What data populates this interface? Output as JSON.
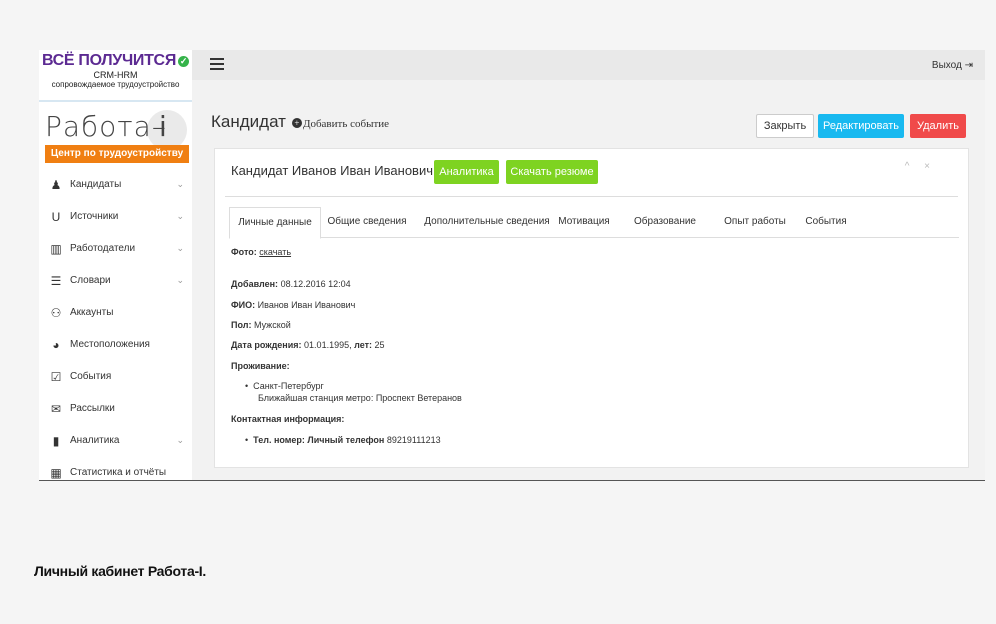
{
  "brand": {
    "title": "ВСЁ ПОЛУЧИТСЯ",
    "check": "✓",
    "subtitle1": "CRM-HRM",
    "subtitle2": "сопровождаемое трудоустройство"
  },
  "logo": {
    "text": "Работа–",
    "letter": "i",
    "banner": "Центр по трудоустройству"
  },
  "sidebar": {
    "items": [
      {
        "label": "Кандидаты",
        "icon": "person-icon",
        "glyph": "♟",
        "chevron": "⌄"
      },
      {
        "label": "Источники",
        "icon": "magnet-icon",
        "glyph": "U",
        "chevron": "⌄"
      },
      {
        "label": "Работодатели",
        "icon": "institution-icon",
        "glyph": "▥",
        "chevron": "⌄"
      },
      {
        "label": "Словари",
        "icon": "list-icon",
        "glyph": "☰",
        "chevron": "⌄"
      },
      {
        "label": "Аккаунты",
        "icon": "users-icon",
        "glyph": "⚇",
        "chevron": ""
      },
      {
        "label": "Местоположения",
        "icon": "globe-icon",
        "glyph": "◕",
        "chevron": ""
      },
      {
        "label": "События",
        "icon": "calendar-icon",
        "glyph": "☑",
        "chevron": ""
      },
      {
        "label": "Рассылки",
        "icon": "envelope-icon",
        "glyph": "✉",
        "chevron": ""
      },
      {
        "label": "Аналитика",
        "icon": "bar-chart-icon",
        "glyph": "▮",
        "chevron": "⌄"
      },
      {
        "label": "Статистика и отчёты",
        "icon": "table-icon",
        "glyph": "▦",
        "chevron": ""
      }
    ]
  },
  "topbar": {
    "logout": "Выход",
    "logout_icon": "⇥"
  },
  "header": {
    "title": "Кандидат",
    "add_event": "Добавить событие",
    "add_icon": "+",
    "close": "Закрыть",
    "edit": "Редактировать",
    "delete": "Удалить"
  },
  "card": {
    "title": "Кандидат Иванов Иван Иванович",
    "analytics": "Аналитика",
    "resume": "Скачать резюме",
    "controls": "^ ×"
  },
  "tabs": [
    {
      "label": "Личные данные"
    },
    {
      "label": "Общие сведения"
    },
    {
      "label": "Дополнительные сведения"
    },
    {
      "label": "Мотивация"
    },
    {
      "label": "Образование"
    },
    {
      "label": "Опыт работы"
    },
    {
      "label": "События"
    }
  ],
  "details": {
    "photo_label": "Фото:",
    "photo_link": "скачать",
    "added_label": "Добавлен:",
    "added_value": "08.12.2016 12:04",
    "fio_label": "ФИО:",
    "fio_value": "Иванов Иван Иванович",
    "sex_label": "Пол:",
    "sex_value": "Мужской",
    "birth_label": "Дата рождения:",
    "birth_value": "01.01.1995,",
    "age_label": "лет:",
    "age_value": "25",
    "residence_label": "Проживание:",
    "city": "Санкт-Петербург",
    "metro": "Ближайшая станция метро: Проспект Ветеранов",
    "contact_label": "Контактная информация:",
    "phone_label": "Тел. номер: Личный телефон",
    "phone_value": "89219111213",
    "bullet": "•"
  },
  "caption": "Личный кабинет Работа-I."
}
